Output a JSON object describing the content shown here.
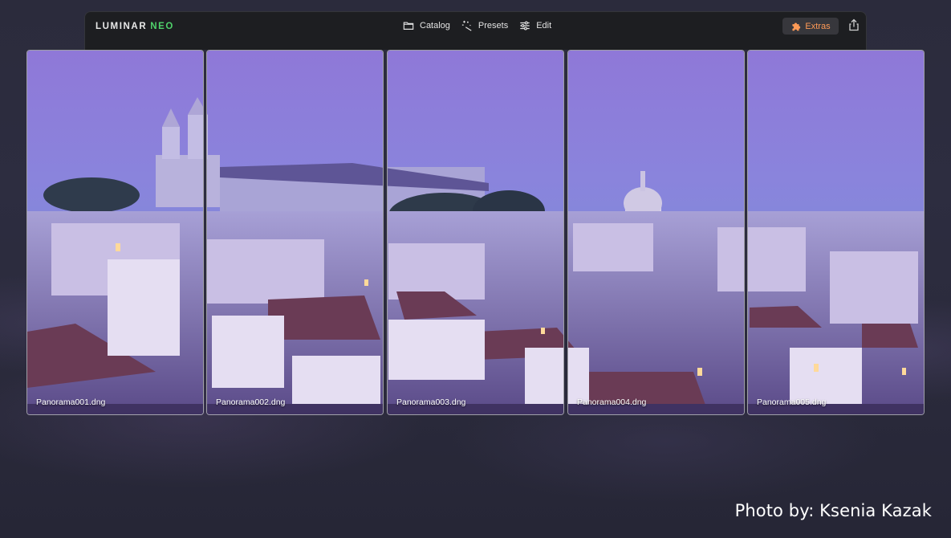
{
  "app": {
    "logo_primary": "LUMINAR",
    "logo_accent": "NEO",
    "accent_color": "#4fd16a"
  },
  "nav": [
    {
      "label": "Catalog",
      "icon": "folder-icon"
    },
    {
      "label": "Presets",
      "icon": "magic-wand-icon"
    },
    {
      "label": "Edit",
      "icon": "sliders-icon"
    }
  ],
  "toolbar": {
    "extras_label": "Extras",
    "extras_icon": "puzzle-icon",
    "extras_color": "#ff9a56",
    "share_icon": "share-icon"
  },
  "panorama": {
    "files": [
      "Panorama001.dng",
      "Panorama002.dng",
      "Panorama003.dng",
      "Panorama004.dng",
      "Panorama005.dng"
    ]
  },
  "credit": "Photo by: Ksenia Kazak"
}
